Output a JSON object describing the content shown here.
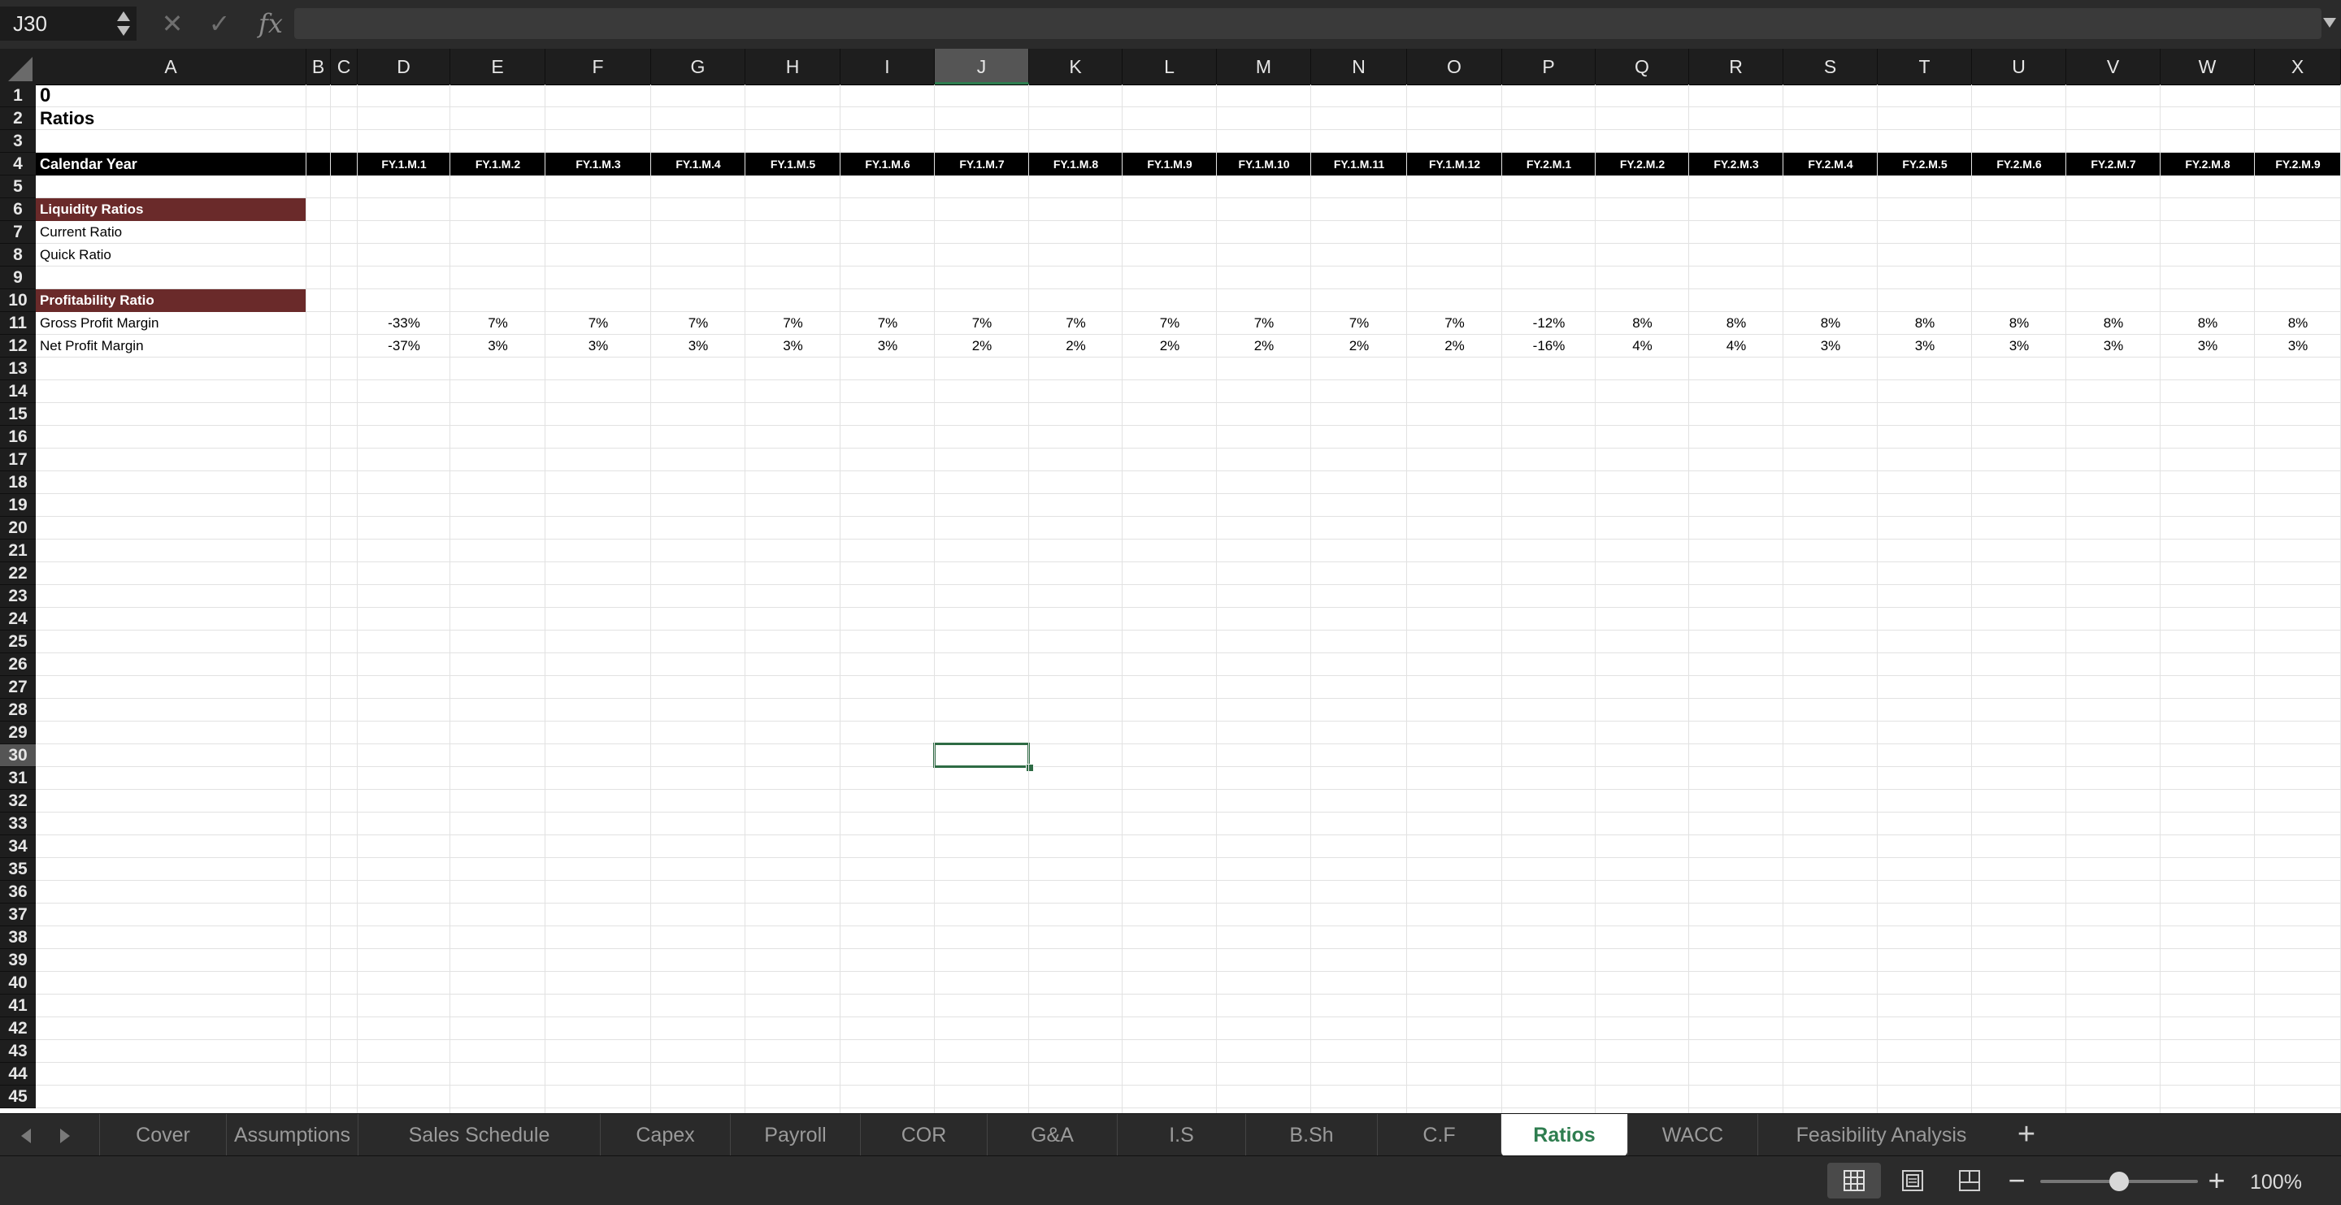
{
  "formula_bar": {
    "name_box": "J30",
    "cancel_glyph": "✕",
    "enter_glyph": "✓",
    "fx_label": "fx",
    "formula": ""
  },
  "columns": [
    "A",
    "B",
    "C",
    "D",
    "E",
    "F",
    "G",
    "H",
    "I",
    "J",
    "K",
    "L",
    "M",
    "N",
    "O",
    "P",
    "Q",
    "R",
    "S",
    "T",
    "U",
    "V",
    "W",
    "X"
  ],
  "selected_column": "J",
  "selected_row": 30,
  "row_numbers": [
    1,
    2,
    3,
    4,
    5,
    6,
    7,
    8,
    9,
    10,
    11,
    12,
    13,
    14,
    15,
    16,
    17,
    18,
    19,
    20,
    21,
    22,
    23,
    24,
    25,
    26,
    27,
    28,
    29,
    30,
    31,
    32,
    33,
    34,
    35,
    36,
    37,
    38,
    39,
    40,
    41,
    42,
    43,
    44,
    45
  ],
  "sheet": {
    "a1": "0",
    "title": "Ratios",
    "header_label": "Calendar Year",
    "periods": [
      "FY.1.M.1",
      "FY.1.M.2",
      "FY.1.M.3",
      "FY.1.M.4",
      "FY.1.M.5",
      "FY.1.M.6",
      "FY.1.M.7",
      "FY.1.M.8",
      "FY.1.M.9",
      "FY.1.M.10",
      "FY.1.M.11",
      "FY.1.M.12",
      "FY.2.M.1",
      "FY.2.M.2",
      "FY.2.M.3",
      "FY.2.M.4",
      "FY.2.M.5",
      "FY.2.M.6",
      "FY.2.M.7",
      "FY.2.M.8",
      "FY.2.M.9"
    ],
    "liquidity_header": "Liquidity Ratios",
    "current_ratio_label": "Current Ratio",
    "quick_ratio_label": "Quick Ratio",
    "profitability_header": "Profitability Ratio",
    "gross_margin_label": "Gross Profit Margin",
    "gross_margin_values": [
      "-33%",
      "7%",
      "7%",
      "7%",
      "7%",
      "7%",
      "7%",
      "7%",
      "7%",
      "7%",
      "7%",
      "7%",
      "-12%",
      "8%",
      "8%",
      "8%",
      "8%",
      "8%",
      "8%",
      "8%",
      "8%"
    ],
    "net_margin_label": "Net Profit Margin",
    "net_margin_values": [
      "-37%",
      "3%",
      "3%",
      "3%",
      "3%",
      "3%",
      "2%",
      "2%",
      "2%",
      "2%",
      "2%",
      "2%",
      "-16%",
      "4%",
      "4%",
      "3%",
      "3%",
      "3%",
      "3%",
      "3%",
      "3%"
    ]
  },
  "tabs": [
    {
      "label": "Cover",
      "active": false
    },
    {
      "label": "Assumptions",
      "active": false
    },
    {
      "label": "Sales Schedule",
      "active": false
    },
    {
      "label": "Capex",
      "active": false
    },
    {
      "label": "Payroll",
      "active": false
    },
    {
      "label": "COR",
      "active": false
    },
    {
      "label": "G&A",
      "active": false
    },
    {
      "label": "I.S",
      "active": false
    },
    {
      "label": "B.Sh",
      "active": false
    },
    {
      "label": "C.F",
      "active": false
    },
    {
      "label": "Ratios",
      "active": true
    },
    {
      "label": "WACC",
      "active": false
    },
    {
      "label": "Feasibility Analysis",
      "active": false
    }
  ],
  "add_sheet_label": "+",
  "status": {
    "zoom_out": "−",
    "zoom_in": "+",
    "zoom": "100%",
    "zoom_fraction": 0.5
  },
  "colors": {
    "accent_green": "#2e7d4f",
    "header_band": "#000000",
    "section_band": "#6a2a2a"
  }
}
